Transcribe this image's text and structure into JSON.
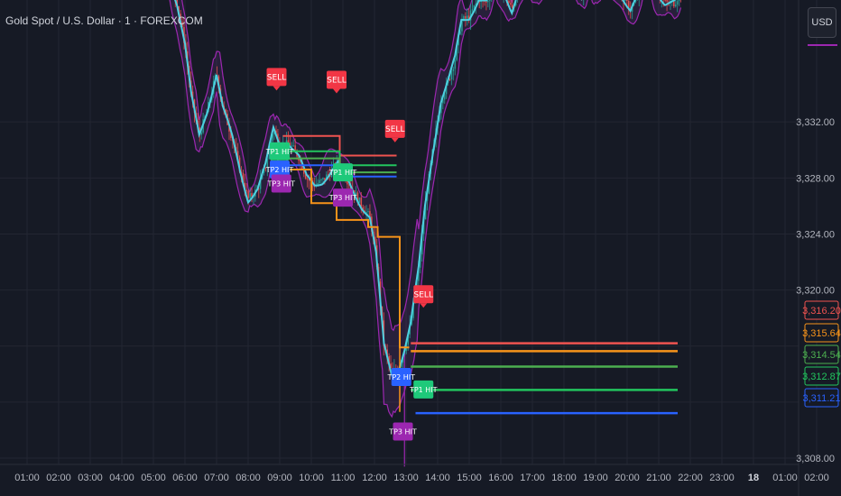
{
  "header": {
    "title": "Gold Spot / U.S. Dollar · 1 · FOREXCOM"
  },
  "currency_button": {
    "label": "USD"
  },
  "colors": {
    "background": "#161a25",
    "grid": "#232632",
    "candles_up": "#26a69a",
    "candles_down": "#ef5350",
    "ma": "#4dd0e1",
    "bands": "#9c27b0",
    "sell": "#f23645",
    "tp_green": "#1ec97a",
    "tp_purple": "#9c27b0",
    "tp_blue": "#2962ff",
    "line_red": "#ef5350",
    "line_orange": "#f7931a",
    "line_green_dark": "#4caf50",
    "line_green": "#22c55e",
    "line_blue": "#2962ff"
  },
  "chart_data": {
    "type": "line",
    "x_ticks": [
      "01:00",
      "02:00",
      "03:00",
      "04:00",
      "05:00",
      "06:00",
      "07:00",
      "08:00",
      "09:00",
      "10:00",
      "11:00",
      "12:00",
      "13:00",
      "14:00",
      "15:00",
      "16:00",
      "17:00",
      "18:00",
      "19:00",
      "20:00",
      "21:00",
      "22:00",
      "23:00",
      "18",
      "01:00",
      "02:00"
    ],
    "y_ticks": [
      "3,332.00",
      "3,328.00",
      "3,324.00",
      "3,320.00",
      "3,308.00"
    ],
    "ylim": [
      3305.3,
      3340.7
    ],
    "price_series": {
      "time": [
        3.0,
        5.5,
        5.75,
        6.0,
        6.2,
        6.45,
        6.7,
        7.0,
        7.2,
        7.5,
        7.75,
        8.0,
        8.3,
        8.55,
        8.8,
        9.05,
        9.3,
        9.6,
        9.85,
        10.1,
        10.35,
        10.6,
        10.85,
        11.1,
        11.35,
        11.6,
        11.85,
        12.05,
        12.3,
        12.55,
        12.8,
        12.95,
        13.15,
        13.4,
        13.6,
        13.85,
        14.1,
        14.35,
        14.55,
        14.75,
        15.0,
        15.3,
        15.55,
        15.8,
        16.1,
        16.35,
        16.6,
        16.85,
        17.1,
        17.35,
        17.6,
        17.85,
        18.05,
        18.3,
        18.55,
        18.8,
        19.05,
        19.3,
        19.6,
        19.85,
        20.1,
        20.3,
        20.55,
        20.75,
        20.95,
        21.2,
        21.5,
        21.75
      ],
      "value": [
        3343.0,
        3342.3,
        3340.5,
        3337.5,
        3333.8,
        3331.0,
        3332.8,
        3335.5,
        3333.0,
        3330.8,
        3328.5,
        3326.5,
        3327.2,
        3328.8,
        3331.5,
        3330.2,
        3330.5,
        3329.5,
        3328.0,
        3327.5,
        3327.8,
        3328.4,
        3329.0,
        3328.0,
        3327.0,
        3326.0,
        3325.2,
        3322.5,
        3316.0,
        3314.0,
        3314.7,
        3315.8,
        3317.6,
        3321.5,
        3326.0,
        3330.0,
        3333.5,
        3335.0,
        3336.5,
        3339.2,
        3339.5,
        3340.8,
        3340.5,
        3342.0,
        3341.3,
        3340.0,
        3341.7,
        3342.7,
        3341.3,
        3342.5,
        3343.5,
        3342.2,
        3343.0,
        3342.3,
        3341.0,
        3342.5,
        3341.5,
        3343.0,
        3342.0,
        3341.0,
        3340.0,
        3340.8,
        3342.5,
        3342.5,
        3341.3,
        3340.5,
        3340.5,
        3341.5
      ]
    },
    "levels": [
      {
        "color": "#ef5350",
        "start_time": 13.15,
        "end_time": 21.6,
        "value": 3316.2
      },
      {
        "color": "#f7931a",
        "start_time": 13.15,
        "end_time": 21.6,
        "value": 3315.64
      },
      {
        "color": "#4caf50",
        "start_time": 13.15,
        "end_time": 21.6,
        "value": 3314.54
      },
      {
        "color": "#22c55e",
        "start_time": 13.15,
        "end_time": 21.6,
        "value": 3312.87
      },
      {
        "color": "#2962ff",
        "start_time": 13.3,
        "end_time": 21.6,
        "value": 3311.21
      }
    ],
    "price_tags": [
      {
        "text": "3,316.20",
        "color": "#ef5350"
      },
      {
        "text": "3,315.64",
        "color": "#f7931a"
      },
      {
        "text": "3,314.54",
        "color": "#4caf50"
      },
      {
        "text": "3,312.87",
        "color": "#22c55e"
      },
      {
        "text": "3,311.21",
        "color": "#2962ff"
      }
    ],
    "sell_signals": [
      {
        "label": "SELL",
        "time": 8.9,
        "value": 3334.3
      },
      {
        "label": "SELL",
        "time": 10.8,
        "value": 3334.1
      },
      {
        "label": "SELL",
        "time": 12.65,
        "value": 3330.6
      },
      {
        "label": "SELL",
        "time": 13.55,
        "value": 3318.8
      }
    ],
    "tp_badges": [
      {
        "label": "TP1 HIT",
        "time": 9.0,
        "value": 3329.9,
        "color": "#1ec97a"
      },
      {
        "label": "TP2 HIT",
        "time": 9.0,
        "value": 3328.6,
        "color": "#2962ff"
      },
      {
        "label": "TP3 HIT",
        "time": 9.05,
        "value": 3327.6,
        "color": "#9c27b0"
      },
      {
        "label": "TP1 HIT",
        "time": 11.0,
        "value": 3328.4,
        "color": "#1ec97a"
      },
      {
        "label": "TP3 HIT",
        "time": 11.0,
        "value": 3326.6,
        "color": "#9c27b0"
      },
      {
        "label": "TP2 HIT",
        "time": 12.85,
        "value": 3313.8,
        "color": "#2962ff"
      },
      {
        "label": "TP1 HIT",
        "time": 13.55,
        "value": 3312.9,
        "color": "#1ec97a"
      },
      {
        "label": "TP3 HIT",
        "time": 12.9,
        "value": 3309.9,
        "color": "#9c27b0"
      }
    ],
    "grid": true
  }
}
